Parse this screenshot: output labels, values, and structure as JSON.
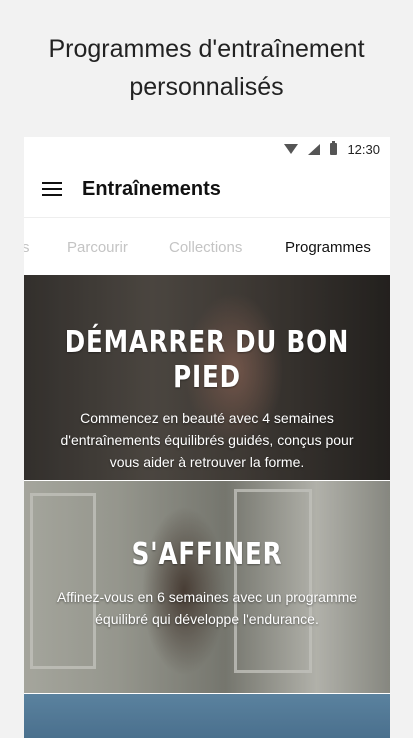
{
  "promo": {
    "line1": "Programmes d'entraînement",
    "line2": "personnalisés"
  },
  "status": {
    "time": "12:30"
  },
  "appbar": {
    "title": "Entraînements"
  },
  "tabs": [
    {
      "label": "s"
    },
    {
      "label": "Parcourir"
    },
    {
      "label": "Collections"
    },
    {
      "label": "Programmes",
      "active": true
    }
  ],
  "cards": [
    {
      "title": "DÉMARRER DU BON PIED",
      "description": "Commencez en beauté avec 4 semaines d'entraînements équilibrés guidés, conçus pour vous aider à retrouver la forme."
    },
    {
      "title": "S'AFFINER",
      "description": "Affinez-vous en 6 semaines avec un programme équilibré qui développe l'endurance."
    },
    {
      "title": ""
    }
  ],
  "colors": {
    "accent": "#111111",
    "inactive_tab": "#c4c4c4",
    "background": "#f2f2f2"
  }
}
